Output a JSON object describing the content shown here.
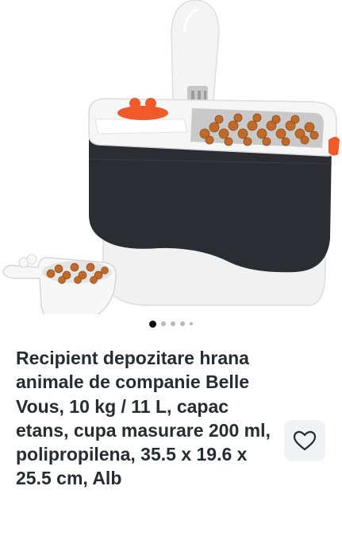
{
  "product": {
    "title": "Recipient depozitare hrana animale de companie Belle Vous, 10 kg / 11 L, capac etans, cupa masurare 200 ml, polipropilena, 35.5 x 19.6 x 25.5 cm, Alb",
    "image_icon": "pet-food-container-image",
    "favorite_icon": "heart-outline-icon"
  },
  "gallery": {
    "dots": [
      {
        "active": true
      },
      {
        "active": false
      },
      {
        "active": false
      },
      {
        "active": false
      },
      {
        "active": false,
        "small": true
      }
    ]
  },
  "colors": {
    "title": "#272b33",
    "dot_active": "#111111",
    "dot_inactive": "#b8b8b8",
    "favorite_bg": "#f1f3f5",
    "accent_orange": "#f05a28",
    "container_dark": "#2b2d33"
  }
}
